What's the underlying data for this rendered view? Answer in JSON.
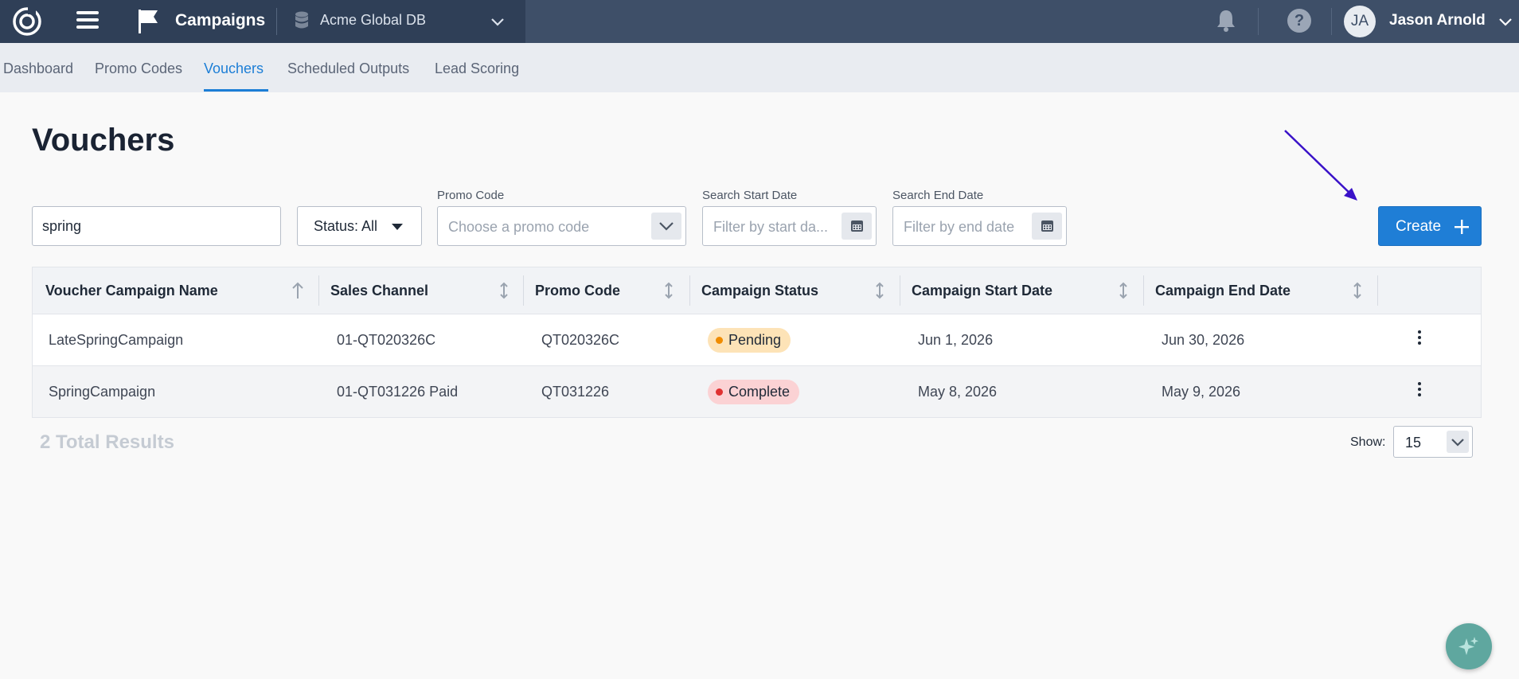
{
  "topbar": {
    "app_name": "Campaigns",
    "database": "Acme Global DB",
    "user_initials": "JA",
    "user_name": "Jason Arnold",
    "help_glyph": "?"
  },
  "subnav": {
    "tabs": [
      {
        "label": "Dashboard",
        "active": false
      },
      {
        "label": "Promo Codes",
        "active": false
      },
      {
        "label": "Vouchers",
        "active": true
      },
      {
        "label": "Scheduled Outputs",
        "active": false
      },
      {
        "label": "Lead Scoring",
        "active": false
      }
    ]
  },
  "page": {
    "title": "Vouchers"
  },
  "filters": {
    "search_value": "spring",
    "status_label": "Status: All",
    "promo_label": "Promo Code",
    "promo_placeholder": "Choose a promo code",
    "start_label": "Search Start Date",
    "start_placeholder": "Filter by start da...",
    "end_label": "Search End Date",
    "end_placeholder": "Filter by end date"
  },
  "create_label": "Create",
  "table": {
    "columns": [
      "Voucher Campaign Name",
      "Sales Channel",
      "Promo Code",
      "Campaign Status",
      "Campaign Start Date",
      "Campaign End Date"
    ],
    "rows": [
      {
        "name": "LateSpringCampaign",
        "channel": "01-QT020326C",
        "promo": "QT020326C",
        "status": "Pending",
        "start": "Jun 1, 2026",
        "end": "Jun 30, 2026"
      },
      {
        "name": "SpringCampaign",
        "channel": "01-QT031226 Paid",
        "promo": "QT031226",
        "status": "Complete",
        "start": "May 8, 2026",
        "end": "May 9, 2026"
      }
    ]
  },
  "footer": {
    "total_results": "2 Total Results",
    "show_label": "Show:",
    "page_size": "15"
  },
  "colors": {
    "topbar": "#3e4f68",
    "accent": "#1f7ed6",
    "pending": "#f08c00",
    "complete": "#e03131",
    "annotation_arrow": "#3a12c8"
  },
  "icons": [
    "app-logo-icon",
    "menu-icon",
    "flag-icon",
    "database-icon",
    "chevron-down-icon",
    "bell-icon",
    "help-icon",
    "calendar-icon",
    "plus-icon",
    "sort-icon",
    "kebab-icon",
    "sparkle-icon"
  ]
}
